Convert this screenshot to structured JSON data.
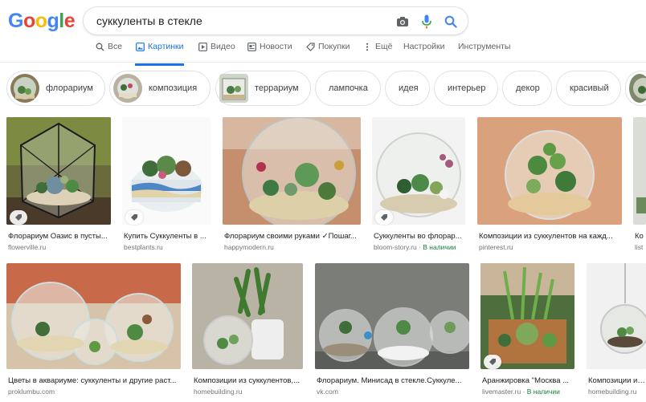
{
  "logo": {
    "letters": [
      "G",
      "o",
      "o",
      "g",
      "l",
      "e"
    ],
    "colors": [
      "#4285F4",
      "#EA4335",
      "#FBBC05",
      "#4285F4",
      "#34A853",
      "#EA4335"
    ]
  },
  "search": {
    "query": "суккуленты в стекле"
  },
  "tabs": [
    {
      "label": "Все",
      "icon": "search-icon",
      "active": false
    },
    {
      "label": "Картинки",
      "icon": "image-icon",
      "active": true
    },
    {
      "label": "Видео",
      "icon": "video-icon",
      "active": false
    },
    {
      "label": "Новости",
      "icon": "news-icon",
      "active": false
    },
    {
      "label": "Покупки",
      "icon": "tag-icon",
      "active": false
    },
    {
      "label": "Ещё",
      "icon": "more-vert-icon",
      "active": false
    },
    {
      "label": "Настройки",
      "icon": "",
      "active": false
    },
    {
      "label": "Инструменты",
      "icon": "",
      "active": false
    }
  ],
  "chips": [
    {
      "label": "флорариум"
    },
    {
      "label": "композиция"
    },
    {
      "label": "террариум"
    },
    {
      "label": "лампочка"
    },
    {
      "label": "идея"
    },
    {
      "label": "интерьер"
    },
    {
      "label": "декор"
    },
    {
      "label": "красивый"
    }
  ],
  "results_row1": [
    {
      "title": "Флорариум Оазис в пусты...",
      "source": "flowerville.ru",
      "stock": ""
    },
    {
      "title": "Купить Суккуленты в ...",
      "source": "bestplants.ru",
      "stock": ""
    },
    {
      "title": "Флорариум своими руками ✓Пошаг...",
      "source": "happymodern.ru",
      "stock": ""
    },
    {
      "title": "Суккуленты во флорар...",
      "source": "bloom-story.ru",
      "stock": "В наличии"
    },
    {
      "title": "Композиции из суккулентов на кажд...",
      "source": "pinterest.ru",
      "stock": ""
    },
    {
      "title": "Ко",
      "source": "list",
      "stock": ""
    }
  ],
  "results_row2": [
    {
      "title": "Цветы в аквариуме: суккуленты и другие раст...",
      "source": "proklumbu.com",
      "stock": ""
    },
    {
      "title": "Композиции из суккулентов,...",
      "source": "homebuilding.ru",
      "stock": ""
    },
    {
      "title": "Флорариум. Минисад в стекле.Суккуле...",
      "source": "vk.com",
      "stock": ""
    },
    {
      "title": "Аранжировка \"Москва ...",
      "source": "livemaster.ru",
      "stock": "В наличии"
    },
    {
      "title": "Композиции из су...",
      "source": "homebuilding.ru",
      "stock": ""
    }
  ],
  "colors": {
    "accent": "#1a73e8",
    "stock_green": "#188038"
  }
}
